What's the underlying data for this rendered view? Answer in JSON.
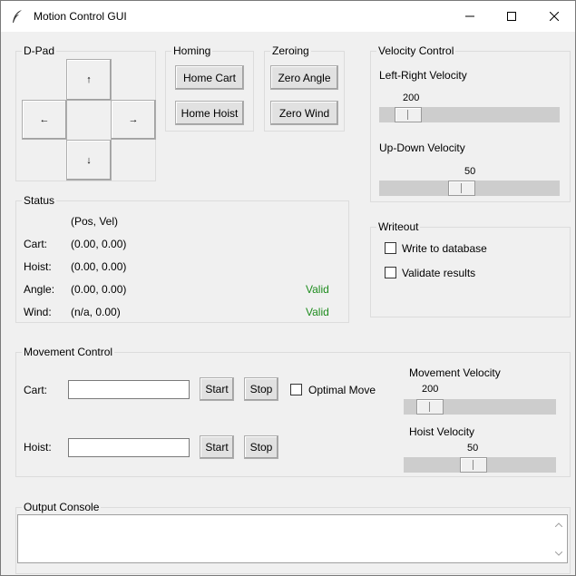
{
  "window": {
    "title": "Motion Control GUI",
    "icons": {
      "app": "feather-icon",
      "minimize": "minimize-icon",
      "maximize": "maximize-icon",
      "close": "close-icon"
    }
  },
  "dpad": {
    "label": "D-Pad",
    "up": "↑",
    "left": "←",
    "right": "→",
    "down": "↓"
  },
  "homing": {
    "label": "Homing",
    "home_cart": "Home Cart",
    "home_hoist": "Home Hoist"
  },
  "zeroing": {
    "label": "Zeroing",
    "zero_angle": "Zero Angle",
    "zero_wind": "Zero Wind"
  },
  "velocity_control": {
    "label": "Velocity Control",
    "left_right_label": "Left-Right Velocity",
    "left_right_value": "200",
    "left_right_fraction": 0.1,
    "up_down_label": "Up-Down Velocity",
    "up_down_value": "50",
    "up_down_fraction": 0.45
  },
  "status": {
    "label": "Status",
    "header": "(Pos, Vel)",
    "rows": [
      {
        "name": "Cart:",
        "value": "(0.00, 0.00)",
        "flag": ""
      },
      {
        "name": "Hoist:",
        "value": "(0.00, 0.00)",
        "flag": ""
      },
      {
        "name": "Angle:",
        "value": "(0.00, 0.00)",
        "flag": "Valid"
      },
      {
        "name": "Wind:",
        "value": "(n/a, 0.00)",
        "flag": "Valid"
      }
    ]
  },
  "writeout": {
    "label": "Writeout",
    "write_db": "Write to database",
    "validate": "Validate results"
  },
  "movement": {
    "label": "Movement Control",
    "cart_label": "Cart:",
    "cart_value": "",
    "hoist_label": "Hoist:",
    "hoist_value": "",
    "start": "Start",
    "stop": "Stop",
    "optimal": "Optimal Move",
    "movement_velocity_label": "Movement Velocity",
    "movement_velocity_value": "200",
    "movement_velocity_fraction": 0.1,
    "hoist_velocity_label": "Hoist Velocity",
    "hoist_velocity_value": "50",
    "hoist_velocity_fraction": 0.45
  },
  "console": {
    "label": "Output Console",
    "content": ""
  }
}
